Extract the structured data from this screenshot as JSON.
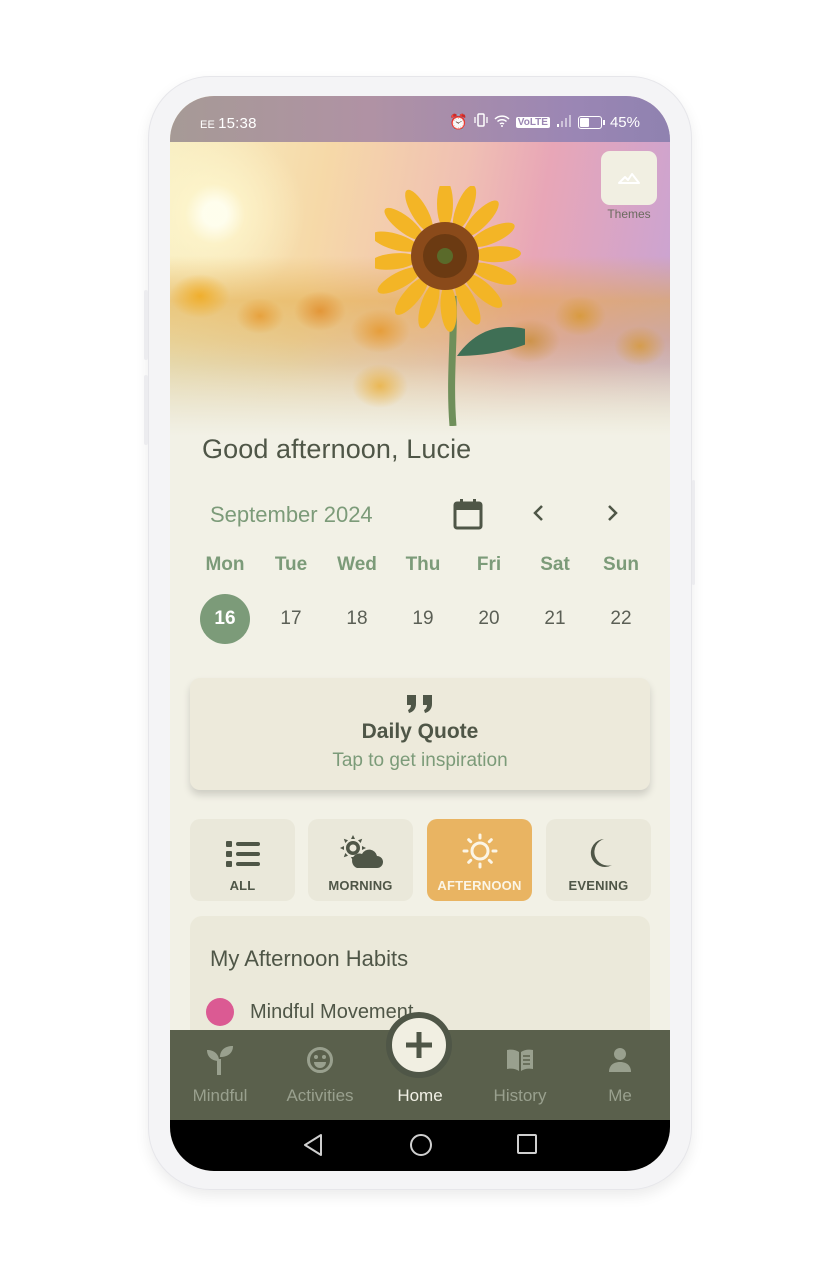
{
  "status_bar": {
    "carrier": "EE",
    "time": "15:38",
    "volte": "VoLTE",
    "battery": "45%"
  },
  "hero": {
    "themes_label": "Themes"
  },
  "greeting": "Good afternoon, Lucie",
  "calendar": {
    "month": "September 2024",
    "days": [
      {
        "name": "Mon",
        "num": "16",
        "selected": true
      },
      {
        "name": "Tue",
        "num": "17"
      },
      {
        "name": "Wed",
        "num": "18"
      },
      {
        "name": "Thu",
        "num": "19"
      },
      {
        "name": "Fri",
        "num": "20"
      },
      {
        "name": "Sat",
        "num": "21"
      },
      {
        "name": "Sun",
        "num": "22"
      }
    ]
  },
  "quote_card": {
    "icon": "”",
    "title": "Daily Quote",
    "subtitle": "Tap to get inspiration"
  },
  "filters": [
    {
      "label": "ALL",
      "icon": "list-icon"
    },
    {
      "label": "MORNING",
      "icon": "sun-cloud-icon"
    },
    {
      "label": "AFTERNOON",
      "icon": "sun-icon",
      "active": true
    },
    {
      "label": "EVENING",
      "icon": "moon-icon"
    }
  ],
  "habits": {
    "title": "My Afternoon Habits",
    "items": [
      {
        "label": "Mindful Movement",
        "color": "#db5a93"
      }
    ]
  },
  "bottom_nav": [
    {
      "label": "Mindful",
      "icon": "sprout-icon"
    },
    {
      "label": "Activities",
      "icon": "smiley-icon"
    },
    {
      "label": "Home",
      "icon": "plus-icon",
      "active": true
    },
    {
      "label": "History",
      "icon": "book-icon"
    },
    {
      "label": "Me",
      "icon": "person-icon"
    }
  ],
  "colors": {
    "accent_green": "#7c9b79",
    "dark_text": "#4f5647",
    "active_filter": "#e9b462",
    "nav_bg": "#5a604c",
    "background": "#f2f1e6"
  }
}
